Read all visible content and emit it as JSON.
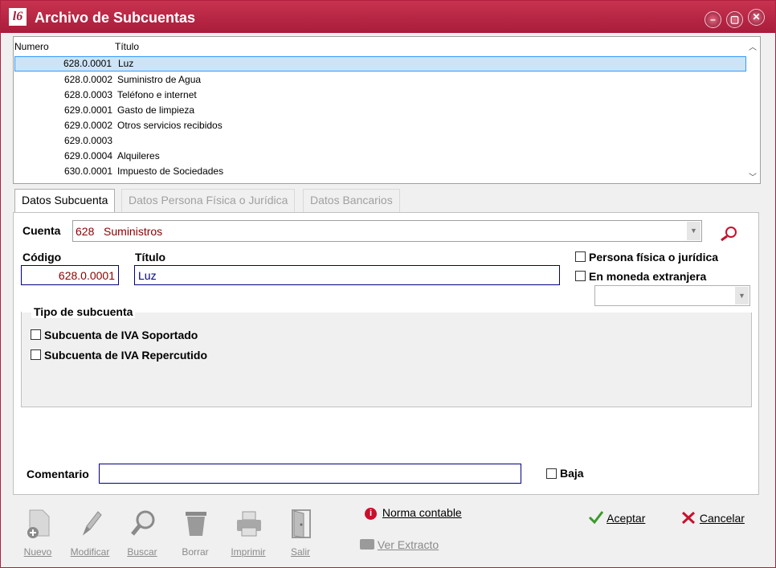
{
  "window": {
    "title": "Archivo de Subcuentas",
    "logo_text": "l6"
  },
  "list": {
    "headers": {
      "numero": "Numero",
      "titulo": "Título"
    },
    "rows": [
      {
        "numero": "628.0.0001",
        "titulo": "Luz",
        "selected": true
      },
      {
        "numero": "628.0.0002",
        "titulo": "Suministro de Agua"
      },
      {
        "numero": "628.0.0003",
        "titulo": "Teléfono e internet"
      },
      {
        "numero": "629.0.0001",
        "titulo": "Gasto de limpieza"
      },
      {
        "numero": "629.0.0002",
        "titulo": "Otros servicios recibidos"
      },
      {
        "numero": "629.0.0003",
        "titulo": ""
      },
      {
        "numero": "629.0.0004",
        "titulo": "Alquileres"
      },
      {
        "numero": "630.0.0001",
        "titulo": "Impuesto de Sociedades"
      }
    ]
  },
  "tabs": [
    {
      "label": "Datos Subcuenta",
      "active": true
    },
    {
      "label": "Datos Persona Física o Jurídica",
      "active": false
    },
    {
      "label": "Datos Bancarios",
      "active": false
    }
  ],
  "form": {
    "cuenta_label": "Cuenta",
    "cuenta_value": "628   Suministros",
    "codigo_label": "Código",
    "codigo_value": "628.0.0001",
    "titulo_label": "Título",
    "titulo_value": "Luz",
    "persona_fisica_label": "Persona física o jurídica",
    "moneda_extranjera_label": "En moneda extranjera",
    "moneda_value": "",
    "tipo_group_title": "Tipo de subcuenta",
    "iva_soportado_label": "Subcuenta de IVA Soportado",
    "iva_repercutido_label": "Subcuenta de IVA Repercutido",
    "comentario_label": "Comentario",
    "comentario_value": "",
    "baja_label": "Baja"
  },
  "toolbar": {
    "nuevo": "Nuevo",
    "modificar": "Modificar",
    "buscar": "Buscar",
    "borrar": "Borrar",
    "imprimir": "Imprimir",
    "salir": "Salir"
  },
  "actions": {
    "norma_contable": "Norma contable",
    "ver_extracto": "Ver Extracto",
    "aceptar": "Aceptar",
    "cancelar": "Cancelar"
  },
  "colors": {
    "titlebar": "#a81c3b",
    "value_text": "#8b0000",
    "selection": "#cce4f7",
    "accept_icon": "#3a9a2a",
    "cancel_icon": "#c8102e"
  }
}
